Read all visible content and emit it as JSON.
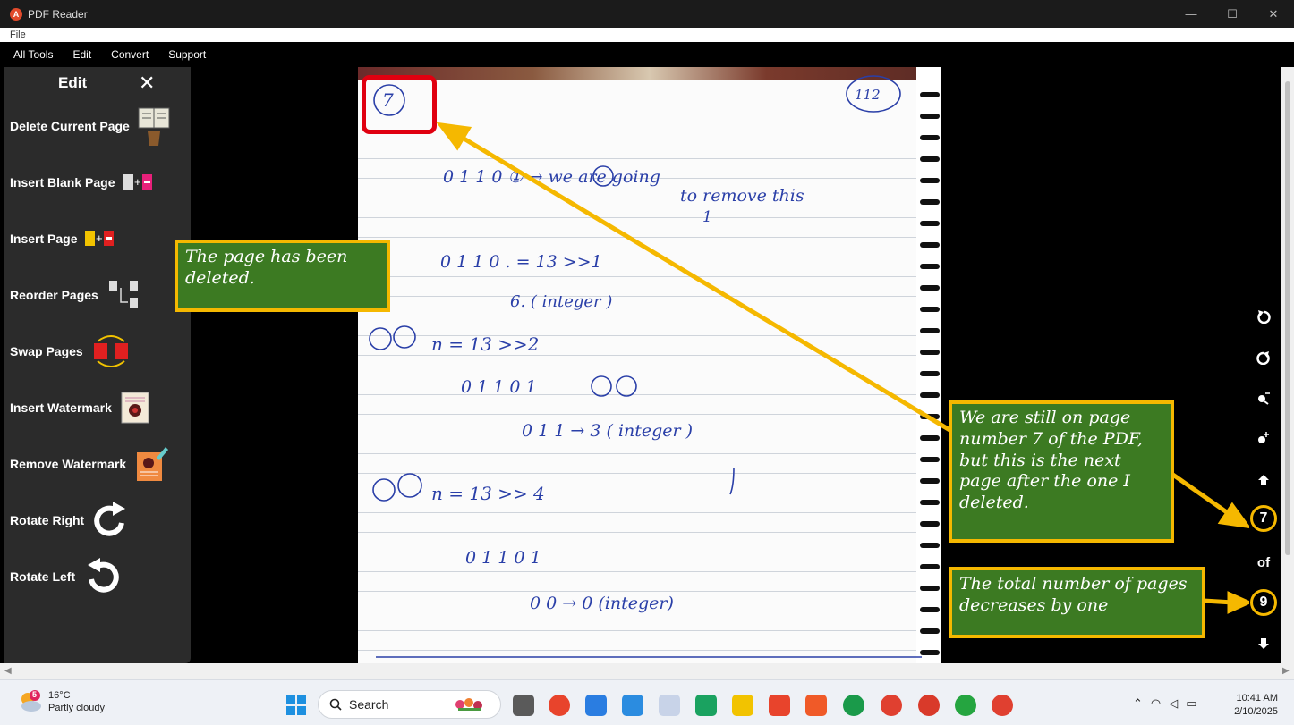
{
  "window": {
    "title": "PDF Reader",
    "minimize": "—",
    "maximize": "☐",
    "close": "✕"
  },
  "file_menu": "File",
  "menubar": [
    "All Tools",
    "Edit",
    "Convert",
    "Support"
  ],
  "sidebar": {
    "title": "Edit",
    "close": "✕",
    "items": [
      {
        "label": "Delete Current Page",
        "icon": "delete-page-icon"
      },
      {
        "label": "Insert Blank Page",
        "icon": "insert-blank-page-icon"
      },
      {
        "label": "Insert Page",
        "icon": "insert-page-icon"
      },
      {
        "label": "Reorder Pages",
        "icon": "reorder-pages-icon"
      },
      {
        "label": "Swap Pages",
        "icon": "swap-pages-icon"
      },
      {
        "label": "Insert Watermark",
        "icon": "insert-watermark-icon"
      },
      {
        "label": "Remove Watermark",
        "icon": "remove-watermark-icon"
      },
      {
        "label": "Rotate Right",
        "icon": "rotate-right-icon"
      },
      {
        "label": "Rotate Left",
        "icon": "rotate-left-icon"
      }
    ]
  },
  "page_nav": {
    "current": "7",
    "of": "of",
    "total": "9"
  },
  "callouts": {
    "deleted": "The page has been deleted.",
    "still_on": "We are still on page number 7 of the PDF, but this is the next page after the one I deleted.",
    "total": "The total number of pages decreases by one"
  },
  "page_content": {
    "page_no": "7",
    "corner_no": "112",
    "lines": [
      "0 1  1  0 ①  →  we are going",
      "to remove this",
      "1",
      "0 1  1 0 . =  13 >>1",
      "6. ( integer )",
      "n = 13 >>2",
      "0  1 1 0 1",
      "0 1 1 → 3 ( integer )",
      "n = 13 >> 4",
      "0 1 1 0 1",
      "0 0 → 0 (integer)"
    ]
  },
  "taskbar": {
    "weather_badge": "5",
    "temperature": "16°C",
    "condition": "Partly cloudy",
    "search": "Search",
    "time": "10:41 AM",
    "date": "2/10/2025"
  }
}
